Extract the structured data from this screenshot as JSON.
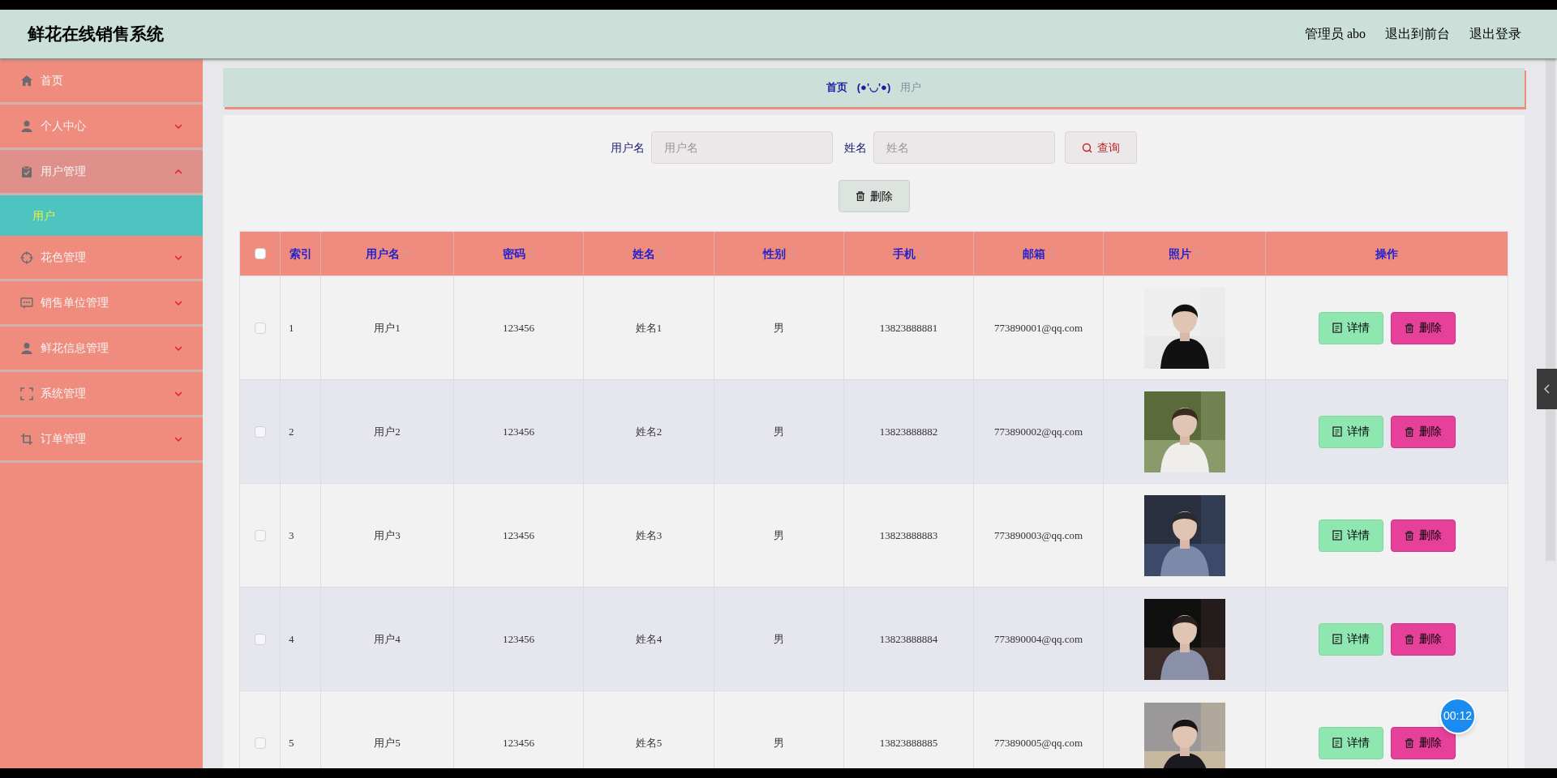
{
  "header": {
    "title": "鲜花在线销售系统",
    "user": "管理员 abo",
    "links": [
      "退出到前台",
      "退出登录"
    ]
  },
  "sidebar": {
    "items": [
      {
        "label": "首页",
        "expandable": false
      },
      {
        "label": "个人中心",
        "expandable": true,
        "expanded": false
      },
      {
        "label": "用户管理",
        "expandable": true,
        "expanded": true,
        "children": [
          {
            "label": "用户",
            "selected": true
          }
        ]
      },
      {
        "label": "花色管理",
        "expandable": true,
        "expanded": false
      },
      {
        "label": "销售单位管理",
        "expandable": true,
        "expanded": false
      },
      {
        "label": "鲜花信息管理",
        "expandable": true,
        "expanded": false
      },
      {
        "label": "系统管理",
        "expandable": true,
        "expanded": false
      },
      {
        "label": "订单管理",
        "expandable": true,
        "expanded": false
      }
    ]
  },
  "breadcrumb": {
    "home": "首页",
    "separator": "(●'◡'●)",
    "current": "用户"
  },
  "search": {
    "fields": [
      {
        "label": "用户名",
        "placeholder": "用户名"
      },
      {
        "label": "姓名",
        "placeholder": "姓名"
      }
    ],
    "button": "查询"
  },
  "toolbar": {
    "delete_button": "删除"
  },
  "table": {
    "header_checked": false,
    "columns": [
      {
        "label": "索引",
        "sortable": false
      },
      {
        "label": "用户名",
        "sortable": true
      },
      {
        "label": "密码",
        "sortable": true
      },
      {
        "label": "姓名",
        "sortable": true
      },
      {
        "label": "性别",
        "sortable": true
      },
      {
        "label": "手机",
        "sortable": true
      },
      {
        "label": "邮箱",
        "sortable": true
      },
      {
        "label": "照片",
        "sortable": true
      },
      {
        "label": "操作",
        "sortable": false
      }
    ],
    "rows": [
      {
        "checked": false,
        "cells": [
          "1",
          "用户1",
          "123456",
          "姓名1",
          "男",
          "13823888881",
          "773890001@qq.com"
        ],
        "photo": {
          "kind": "picture"
        },
        "actions": [
          "详情",
          "删除"
        ]
      },
      {
        "checked": false,
        "cells": [
          "2",
          "用户2",
          "123456",
          "姓名2",
          "男",
          "13823888882",
          "773890002@qq.com"
        ],
        "photo": {
          "kind": "picture"
        },
        "actions": [
          "详情",
          "删除"
        ]
      },
      {
        "checked": false,
        "cells": [
          "3",
          "用户3",
          "123456",
          "姓名3",
          "男",
          "13823888883",
          "773890003@qq.com"
        ],
        "photo": {
          "kind": "picture"
        },
        "actions": [
          "详情",
          "删除"
        ]
      },
      {
        "checked": false,
        "cells": [
          "4",
          "用户4",
          "123456",
          "姓名4",
          "男",
          "13823888884",
          "773890004@qq.com"
        ],
        "photo": {
          "kind": "picture"
        },
        "actions": [
          "详情",
          "删除"
        ]
      },
      {
        "checked": false,
        "cells": [
          "5",
          "用户5",
          "123456",
          "姓名5",
          "男",
          "13823888885",
          "773890005@qq.com"
        ],
        "photo": {
          "kind": "picture"
        },
        "actions": [
          "详情",
          "删除"
        ]
      }
    ]
  },
  "timer": "00:12"
}
